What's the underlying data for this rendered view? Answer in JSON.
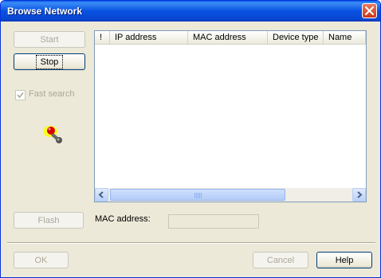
{
  "window": {
    "title": "Browse Network"
  },
  "buttons": {
    "start": "Start",
    "stop": "Stop",
    "flash": "Flash",
    "ok": "OK",
    "cancel": "Cancel",
    "help": "Help"
  },
  "fast_search": {
    "label": "Fast search",
    "checked": true
  },
  "device_list": {
    "columns": [
      "!",
      "IP address",
      "MAC address",
      "Device type",
      "Name"
    ],
    "rows": []
  },
  "mac_address": {
    "label": "MAC address:",
    "value": ""
  },
  "icons": {
    "close": "close-icon",
    "search": "search-network-icon"
  }
}
